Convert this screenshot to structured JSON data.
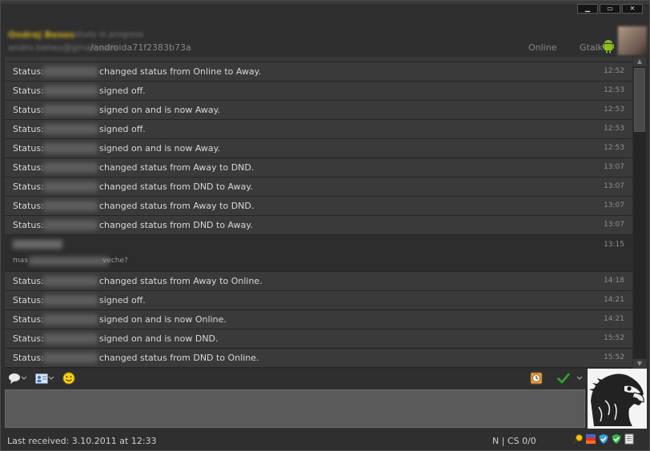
{
  "window": {
    "controls": [
      "minimize",
      "maximize",
      "close"
    ]
  },
  "header": {
    "contact_name": "Ondrej Benes",
    "contact_mood": "study in progress",
    "contact_email": "andro.benes@gmail.com",
    "contact_id": "/androida71f2383b73a",
    "status": "Online",
    "protocol": "Gtalk"
  },
  "log": {
    "status_prefix": "Status:",
    "events": [
      {
        "msg": "changed status from Online to Away.",
        "time": "12:52"
      },
      {
        "msg": "signed off.",
        "time": "12:53"
      },
      {
        "msg": "signed on and is now Away.",
        "time": "12:53"
      },
      {
        "msg": "signed off.",
        "time": "12:53"
      },
      {
        "msg": "signed on and is now Away.",
        "time": "12:53"
      },
      {
        "msg": "changed status from Away to DND.",
        "time": "13:07"
      },
      {
        "msg": "changed status from DND to Away.",
        "time": "13:07"
      },
      {
        "msg": "changed status from Away to DND.",
        "time": "13:07"
      },
      {
        "msg": "changed status from DND to Away.",
        "time": "13:07"
      }
    ],
    "chat": {
      "time": "13:15",
      "text_start": "mas",
      "text_end": "veche?"
    },
    "events2": [
      {
        "msg": "changed status from Away to Online.",
        "time": "14:18"
      },
      {
        "msg": "signed off.",
        "time": "14:21"
      },
      {
        "msg": "signed on and is now Online.",
        "time": "14:21"
      },
      {
        "msg": "signed on and is now DND.",
        "time": "15:52"
      },
      {
        "msg": "changed status from DND to Online.",
        "time": "15:52"
      }
    ]
  },
  "statusbar": {
    "last_received": "Last received: 3.10.2011 at 12:33",
    "chatstate": "N | CS 0/0"
  },
  "icons": {
    "toolbar": [
      "speech-bubble-icon",
      "contact-card-icon",
      "smiley-icon",
      "clock-icon",
      "checkmark-icon"
    ],
    "status": [
      "search-icon",
      "flags-icon",
      "shield-check-icon",
      "shield-check-icon",
      "notes-icon"
    ]
  },
  "colors": {
    "accent_name": "#d4b21c",
    "check_green": "#2ea82e",
    "row_bg": "#3a3a3a"
  }
}
